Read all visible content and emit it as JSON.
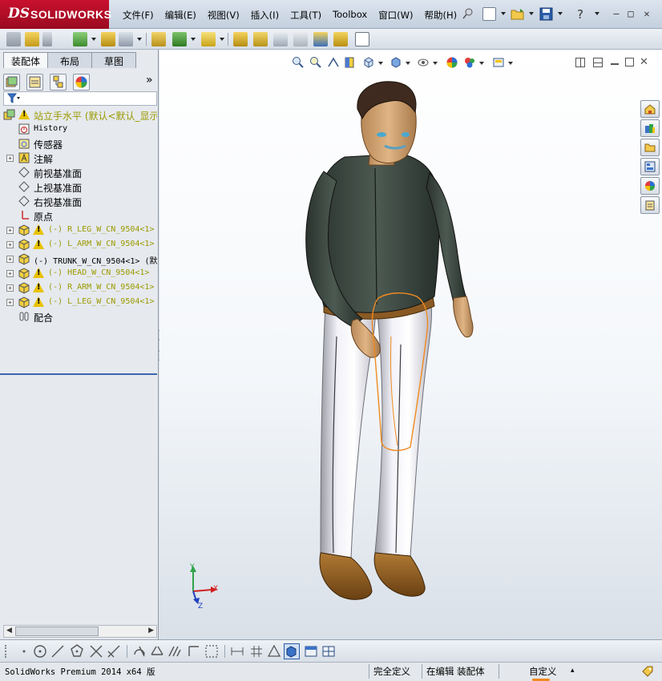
{
  "app": {
    "brand_ds": "DS",
    "brand_name": "SOLIDWORKS"
  },
  "menu": [
    "文件(F)",
    "编辑(E)",
    "视图(V)",
    "插入(I)",
    "工具(T)",
    "Toolbox",
    "窗口(W)",
    "帮助(H)"
  ],
  "quick_access": {
    "help": "?",
    "minimize": "—",
    "restore": "□",
    "close": "✕"
  },
  "feature_manager": {
    "tabs": [
      "装配体",
      "布局",
      "草图"
    ],
    "active_tab": "装配体",
    "more": "»",
    "tree": [
      {
        "label": "站立手水平  (默认<默认_显示",
        "icon": "assembly-icon",
        "warning": true,
        "expander": false,
        "olive": true,
        "mono": false
      },
      {
        "label": "History",
        "icon": "history-icon",
        "warning": false,
        "expander": false,
        "olive": false,
        "mono": true
      },
      {
        "label": "传感器",
        "icon": "sensor-icon",
        "warning": false,
        "expander": false,
        "olive": false,
        "mono": false
      },
      {
        "label": "注解",
        "icon": "annotation-icon",
        "warning": false,
        "expander": true,
        "olive": false,
        "mono": false
      },
      {
        "label": "前视基准面",
        "icon": "plane-icon",
        "warning": false,
        "expander": false,
        "olive": false,
        "mono": false
      },
      {
        "label": "上视基准面",
        "icon": "plane-icon",
        "warning": false,
        "expander": false,
        "olive": false,
        "mono": false
      },
      {
        "label": "右视基准面",
        "icon": "plane-icon",
        "warning": false,
        "expander": false,
        "olive": false,
        "mono": false
      },
      {
        "label": "原点",
        "icon": "origin-icon",
        "warning": false,
        "expander": false,
        "olive": false,
        "mono": false
      },
      {
        "label": "(-) R_LEG_W_CN_9504<1>",
        "icon": "part-icon",
        "warning": true,
        "expander": true,
        "olive": true,
        "mono": true
      },
      {
        "label": "(-) L_ARM_W_CN_9504<1>",
        "icon": "part-icon",
        "warning": true,
        "expander": true,
        "olive": true,
        "mono": true
      },
      {
        "label": "(-) TRUNK_W_CN_9504<1> (默",
        "icon": "part-icon",
        "warning": false,
        "expander": true,
        "olive": false,
        "mono": true
      },
      {
        "label": "(-) HEAD_W_CN_9504<1>",
        "icon": "part-icon",
        "warning": true,
        "expander": true,
        "olive": true,
        "mono": true
      },
      {
        "label": "(-) R_ARM_W_CN_9504<1>",
        "icon": "part-icon",
        "warning": true,
        "expander": true,
        "olive": true,
        "mono": true
      },
      {
        "label": "(-) L_LEG_W_CN_9504<1>",
        "icon": "part-icon",
        "warning": true,
        "expander": true,
        "olive": true,
        "mono": true
      },
      {
        "label": "配合",
        "icon": "mates-icon",
        "warning": false,
        "expander": false,
        "olive": false,
        "mono": false
      }
    ]
  },
  "triad": {
    "x": "X",
    "y": "Y",
    "z": "Z"
  },
  "status": {
    "product": "SolidWorks Premium 2014 x64 版",
    "definition": "完全定义",
    "editing": "在编辑 装配体",
    "units": "自定义",
    "units_caret": "▴"
  },
  "colors": {
    "accent": "#c8102e",
    "olive_text": "#9a9a00",
    "selection_orange": "#f08a20"
  }
}
